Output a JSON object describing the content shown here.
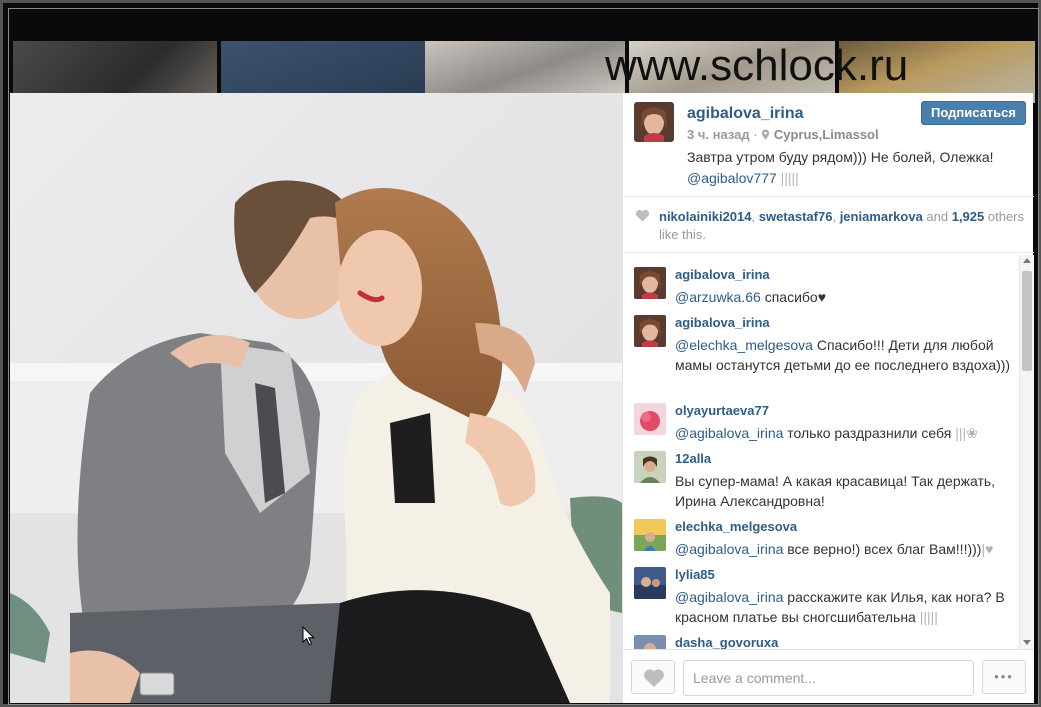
{
  "watermark": "www.schlock.ru",
  "post": {
    "username": "agibalova_irina",
    "time": "3 ч. назад",
    "separator": "·",
    "location": "Cyprus,Limassol",
    "caption_text": "Завтра утром буду рядом))) Не болей, Олежка!",
    "caption_mention": "@agibalov777",
    "caption_tail": "|||||",
    "follow_label": "Подписаться"
  },
  "likes": {
    "user1": "nikolainiki2014",
    "sep1": ", ",
    "user2": "swetastaf76",
    "sep2": ", ",
    "user3": "jeniamarkova",
    "and_text": " and ",
    "count": "1,925",
    "suffix": " others like this."
  },
  "comments": [
    {
      "user": "agibalova_irina",
      "mention": "@arzuwka.66",
      "text": " спасибо♥",
      "tail": ""
    },
    {
      "user": "agibalova_irina",
      "mention": "@elechka_melgesova",
      "text": " Спасибо!!! Дети для любой мамы останутся детьми до ее последнего вздоха)))",
      "tail": ""
    },
    {
      "user": "olyayurtaeva77",
      "mention": "@agibalova_irina",
      "text": " только раздразнили себя ",
      "tail": "|||❀"
    },
    {
      "user": "12alla",
      "mention": "",
      "text": "Вы супер-мама! А какая красавица! Так держать, Ирина Александровна!",
      "tail": ""
    },
    {
      "user": "elechka_melgesova",
      "mention": "@agibalova_irina",
      "text": " все верно!) всех благ Вам!!!)))",
      "tail": "|♥"
    },
    {
      "user": "lylia85",
      "mention": "@agibalova_irina",
      "text": " расскажите как Илья, как нога? В красном платье вы сногсшибательна ",
      "tail": "|||||"
    },
    {
      "user": "dasha_govoruxa",
      "mention": "",
      "text": "",
      "tail": ""
    }
  ],
  "footer": {
    "comment_placeholder": "Leave a comment...",
    "more_label": "•••"
  },
  "icons": {
    "location": "location-pin-icon",
    "heart": "heart-icon",
    "more": "more-icon",
    "cursor": "mouse-cursor-icon"
  },
  "colors": {
    "username": "#2d5d88",
    "follow_button": "#4a7fad",
    "muted": "#9a9a9a"
  }
}
